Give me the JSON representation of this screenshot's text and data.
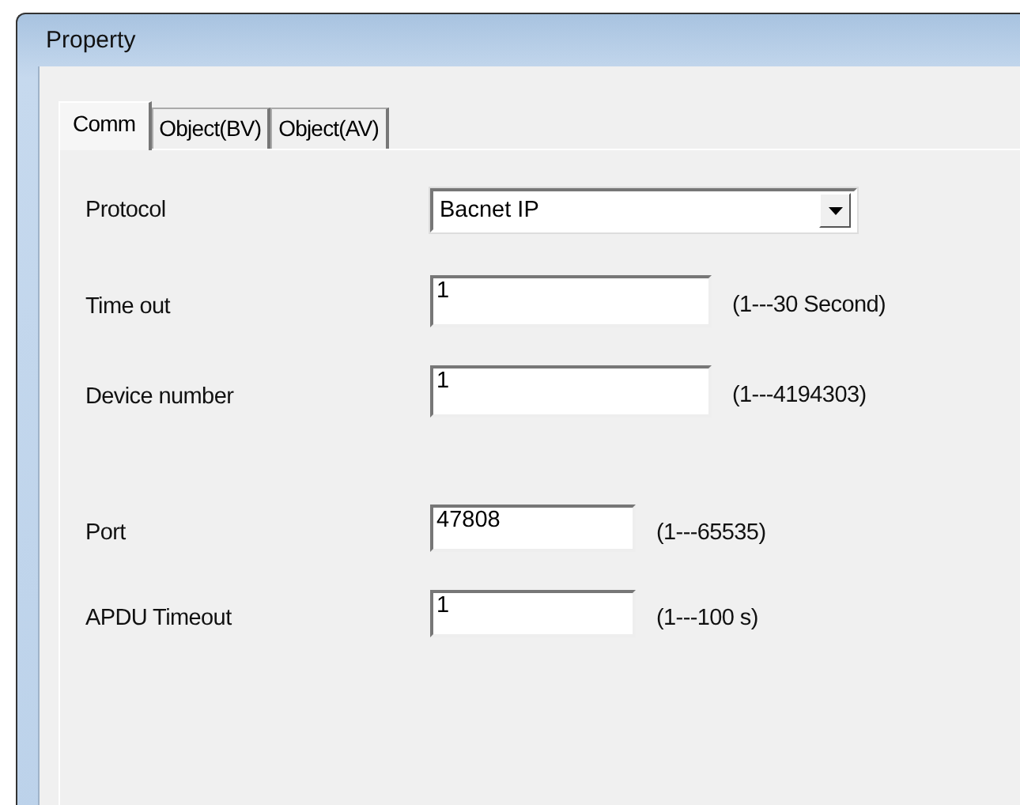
{
  "window": {
    "title": "Property"
  },
  "tabs": [
    {
      "label": "Comm",
      "selected": true
    },
    {
      "label": "Object(BV)",
      "selected": false
    },
    {
      "label": "Object(AV)",
      "selected": false
    }
  ],
  "groups": [
    [
      {
        "kind": "dropdown",
        "label": "Protocol",
        "value": "Bacnet IP"
      },
      {
        "kind": "wide",
        "label": "Time out",
        "value": "1",
        "hint": "(1---30 Second)"
      },
      {
        "kind": "wide",
        "label": "Device number",
        "value": "1",
        "hint": "(1---4194303)"
      }
    ],
    [
      {
        "kind": "short",
        "label": "Port",
        "value": "47808",
        "hint": "(1---65535)"
      },
      {
        "kind": "short",
        "label": "APDU Timeout",
        "value": "1",
        "hint": "(1---100 s)"
      }
    ]
  ]
}
